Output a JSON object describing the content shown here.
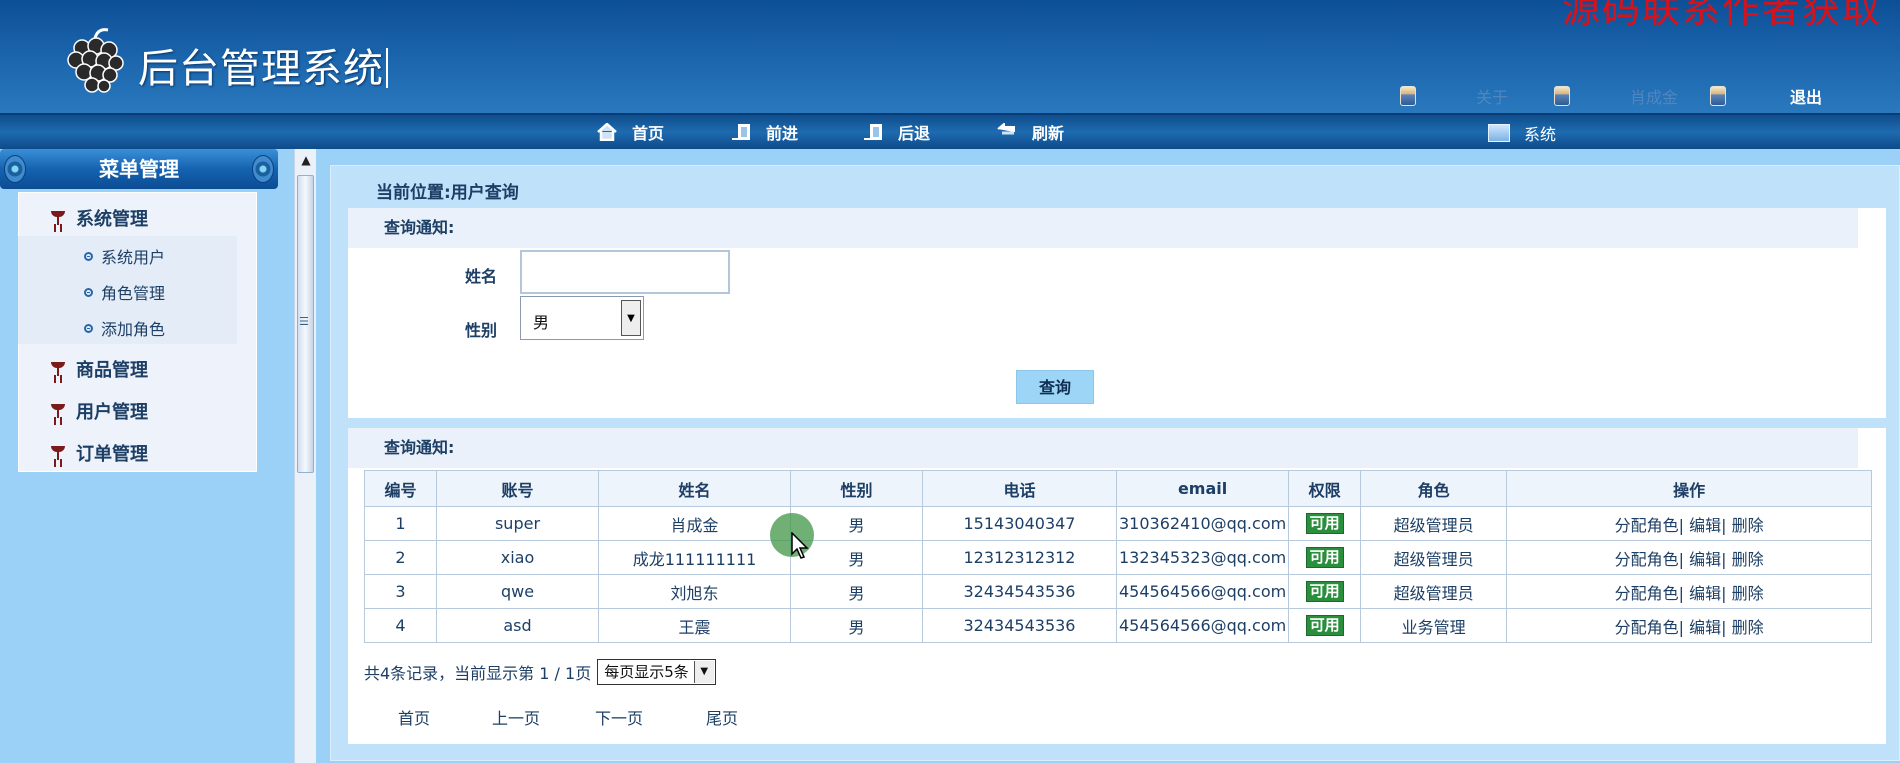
{
  "header": {
    "app_title": "后台管理系统",
    "watermark": "源码联系作者获取"
  },
  "top_links": [
    {
      "label": "关于",
      "icon": "user-icon"
    },
    {
      "label": "肖成金",
      "icon": "user-icon"
    },
    {
      "label": "退出",
      "icon": "user-icon"
    }
  ],
  "nav": {
    "home": "首页",
    "forward": "前进",
    "back": "后退",
    "refresh": "刷新",
    "system": "系统"
  },
  "sidebar": {
    "title": "菜单管理",
    "groups": [
      {
        "label": "系统管理",
        "items": [
          "系统用户",
          "角色管理",
          "添加角色"
        ]
      },
      {
        "label": "商品管理"
      },
      {
        "label": "用户管理"
      },
      {
        "label": "订单管理"
      }
    ]
  },
  "breadcrumb": "当前位置:用户查询",
  "search_panel": {
    "title": "查询通知:",
    "name_label": "姓名",
    "name_value": "",
    "gender_label": "性别",
    "gender_value": "男",
    "query_button": "查询"
  },
  "results_panel": {
    "title": "查询通知:",
    "columns": [
      "编号",
      "账号",
      "姓名",
      "性别",
      "电话",
      "email",
      "权限",
      "角色",
      "操作"
    ],
    "rows": [
      {
        "id": "1",
        "account": "super",
        "name": "肖成金",
        "gender": "男",
        "phone": "15143040347",
        "email": "310362410@qq.com",
        "perm": "可用",
        "role": "超级管理员"
      },
      {
        "id": "2",
        "account": "xiao",
        "name": "成龙111111111",
        "gender": "男",
        "phone": "12312312312",
        "email": "132345323@qq.com",
        "perm": "可用",
        "role": "超级管理员"
      },
      {
        "id": "3",
        "account": "qwe",
        "name": "刘旭东",
        "gender": "男",
        "phone": "32434543536",
        "email": "454564566@qq.com",
        "perm": "可用",
        "role": "超级管理员"
      },
      {
        "id": "4",
        "account": "asd",
        "name": "王震",
        "gender": "男",
        "phone": "32434543536",
        "email": "454564566@qq.com",
        "perm": "可用",
        "role": "业务管理"
      }
    ],
    "ops": {
      "assign": "分配角色",
      "edit": "编辑",
      "delete": "删除",
      "sep": "|"
    },
    "summary": "共4条记录，当前显示第 1 / 1页",
    "page_size": "每页显示5条",
    "pager": {
      "first": "首页",
      "prev": "上一页",
      "next": "下一页",
      "last": "尾页"
    }
  },
  "colors": {
    "header_blue": "#1c67ae",
    "panel_bg": "#9bd0f7",
    "perm_green": "#2a8f3c",
    "watermark_red": "#d8121a"
  }
}
